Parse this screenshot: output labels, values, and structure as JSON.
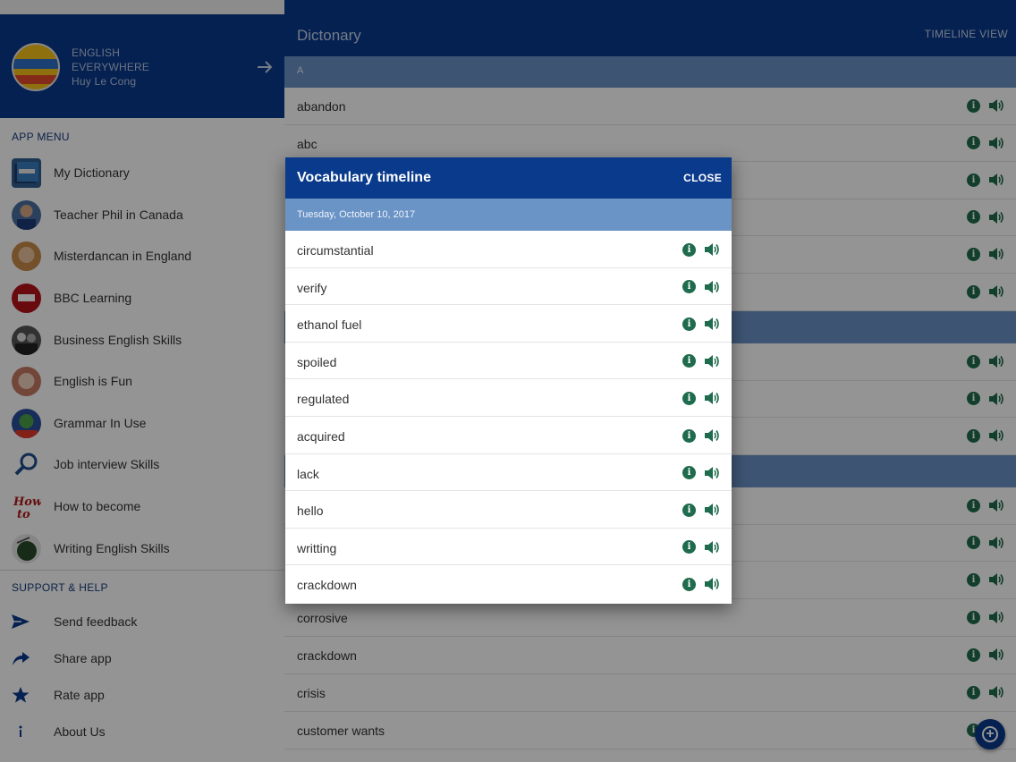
{
  "sidebar": {
    "profile": {
      "line1": "ENGLISH",
      "line2": "EVERYWHERE",
      "user": "Huy Le Cong",
      "avatar_icon": "english-everywhere-logo",
      "arrow_icon": "arrow-right-icon"
    },
    "app_menu_title": "APP MENU",
    "app_menu": [
      {
        "label": "My Dictionary",
        "icon": "dictionary-book-icon"
      },
      {
        "label": "Teacher Phil in Canada",
        "icon": "teacher-avatar"
      },
      {
        "label": "Misterdancan in England",
        "icon": "teacher-avatar"
      },
      {
        "label": "BBC Learning",
        "icon": "bbc-logo"
      },
      {
        "label": "Business English Skills",
        "icon": "business-avatar"
      },
      {
        "label": "English is Fun",
        "icon": "fun-avatar"
      },
      {
        "label": "Grammar In Use",
        "icon": "grammar-logo"
      },
      {
        "label": "Job interview Skills",
        "icon": "job-interview-icon"
      },
      {
        "label": "How to become",
        "icon": "how-to-logo"
      },
      {
        "label": "Writing English Skills",
        "icon": "writing-logo"
      }
    ],
    "support_title": "SUPPORT & HELP",
    "support_menu": [
      {
        "label": "Send feedback",
        "icon": "send-icon"
      },
      {
        "label": "Share app",
        "icon": "share-icon"
      },
      {
        "label": "Rate app",
        "icon": "star-icon"
      },
      {
        "label": "About Us",
        "icon": "info-icon"
      }
    ]
  },
  "main": {
    "title": "Dictonary",
    "timeline_view": "TIMELINE VIEW",
    "letter_a": "A",
    "words_top": [
      "abandon",
      "abc",
      "",
      "",
      "",
      ""
    ],
    "words_bottom": [
      "corrosive",
      "crackdown",
      "crisis",
      "customer wants"
    ],
    "fab_icon": "add-icon"
  },
  "dialog": {
    "title": "Vocabulary timeline",
    "close": "CLOSE",
    "date": "Tuesday, October 10, 2017",
    "words": [
      "circumstantial",
      "verify",
      "ethanol fuel",
      "spoiled",
      "regulated",
      "acquired",
      "lack",
      "hello",
      "writting",
      "crackdown"
    ]
  },
  "colors": {
    "primary": "#0a3a8c",
    "band": "#6a93c6",
    "icon_green": "#1f6b4d"
  }
}
